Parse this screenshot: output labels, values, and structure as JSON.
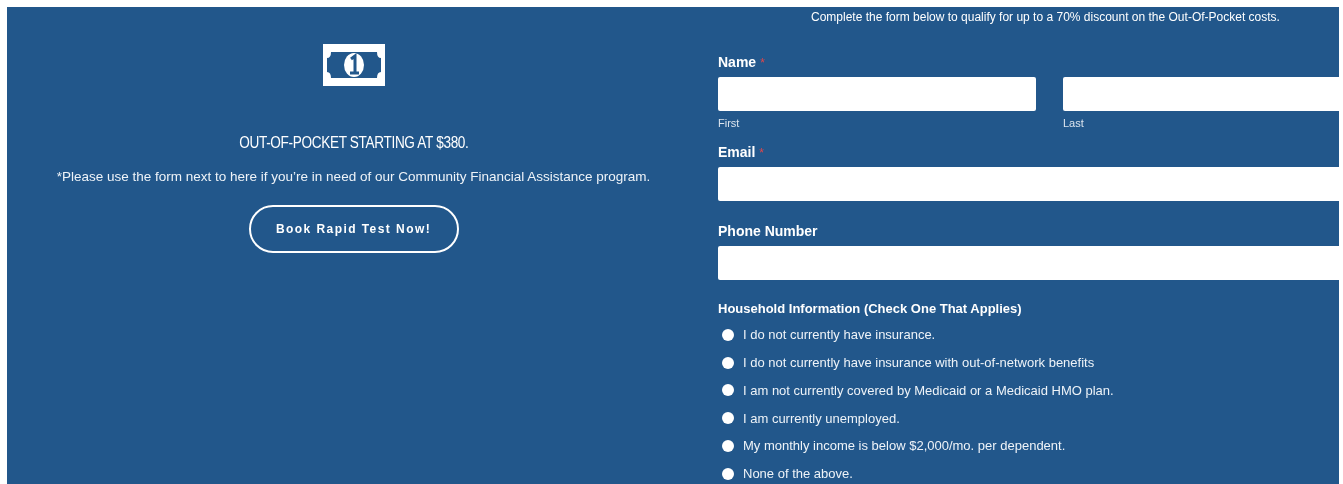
{
  "intro": {
    "heading": "OUT-OF-POCKET STARTING AT $380.",
    "note": "*Please use the form next to here if you’re in need of our Community Financial Assistance program.",
    "button": "Book Rapid Test Now!"
  },
  "form": {
    "notice": "Complete the form below to qualify for up to a 70% discount on the Out-Of-Pocket costs.",
    "name": {
      "label": "Name",
      "required_mark": "*",
      "first": "First",
      "last": "Last"
    },
    "email": {
      "label": "Email",
      "required_mark": "*"
    },
    "phone": {
      "label": "Phone Number"
    },
    "household": {
      "label": "Household Information (Check One That Applies)",
      "options": [
        {
          "label": "I do not currently have insurance.",
          "selected": false
        },
        {
          "label": "I do not currently have insurance with out-of-network benefits",
          "selected": false
        },
        {
          "label": "I am not currently covered by Medicaid or a Medicaid HMO plan.",
          "selected": false
        },
        {
          "label": "I am currently unemployed.",
          "selected": false
        },
        {
          "label": "My monthly income is below $2,000/mo. per dependent.",
          "selected": false
        },
        {
          "label": "None of the above.",
          "selected": false
        }
      ]
    }
  }
}
